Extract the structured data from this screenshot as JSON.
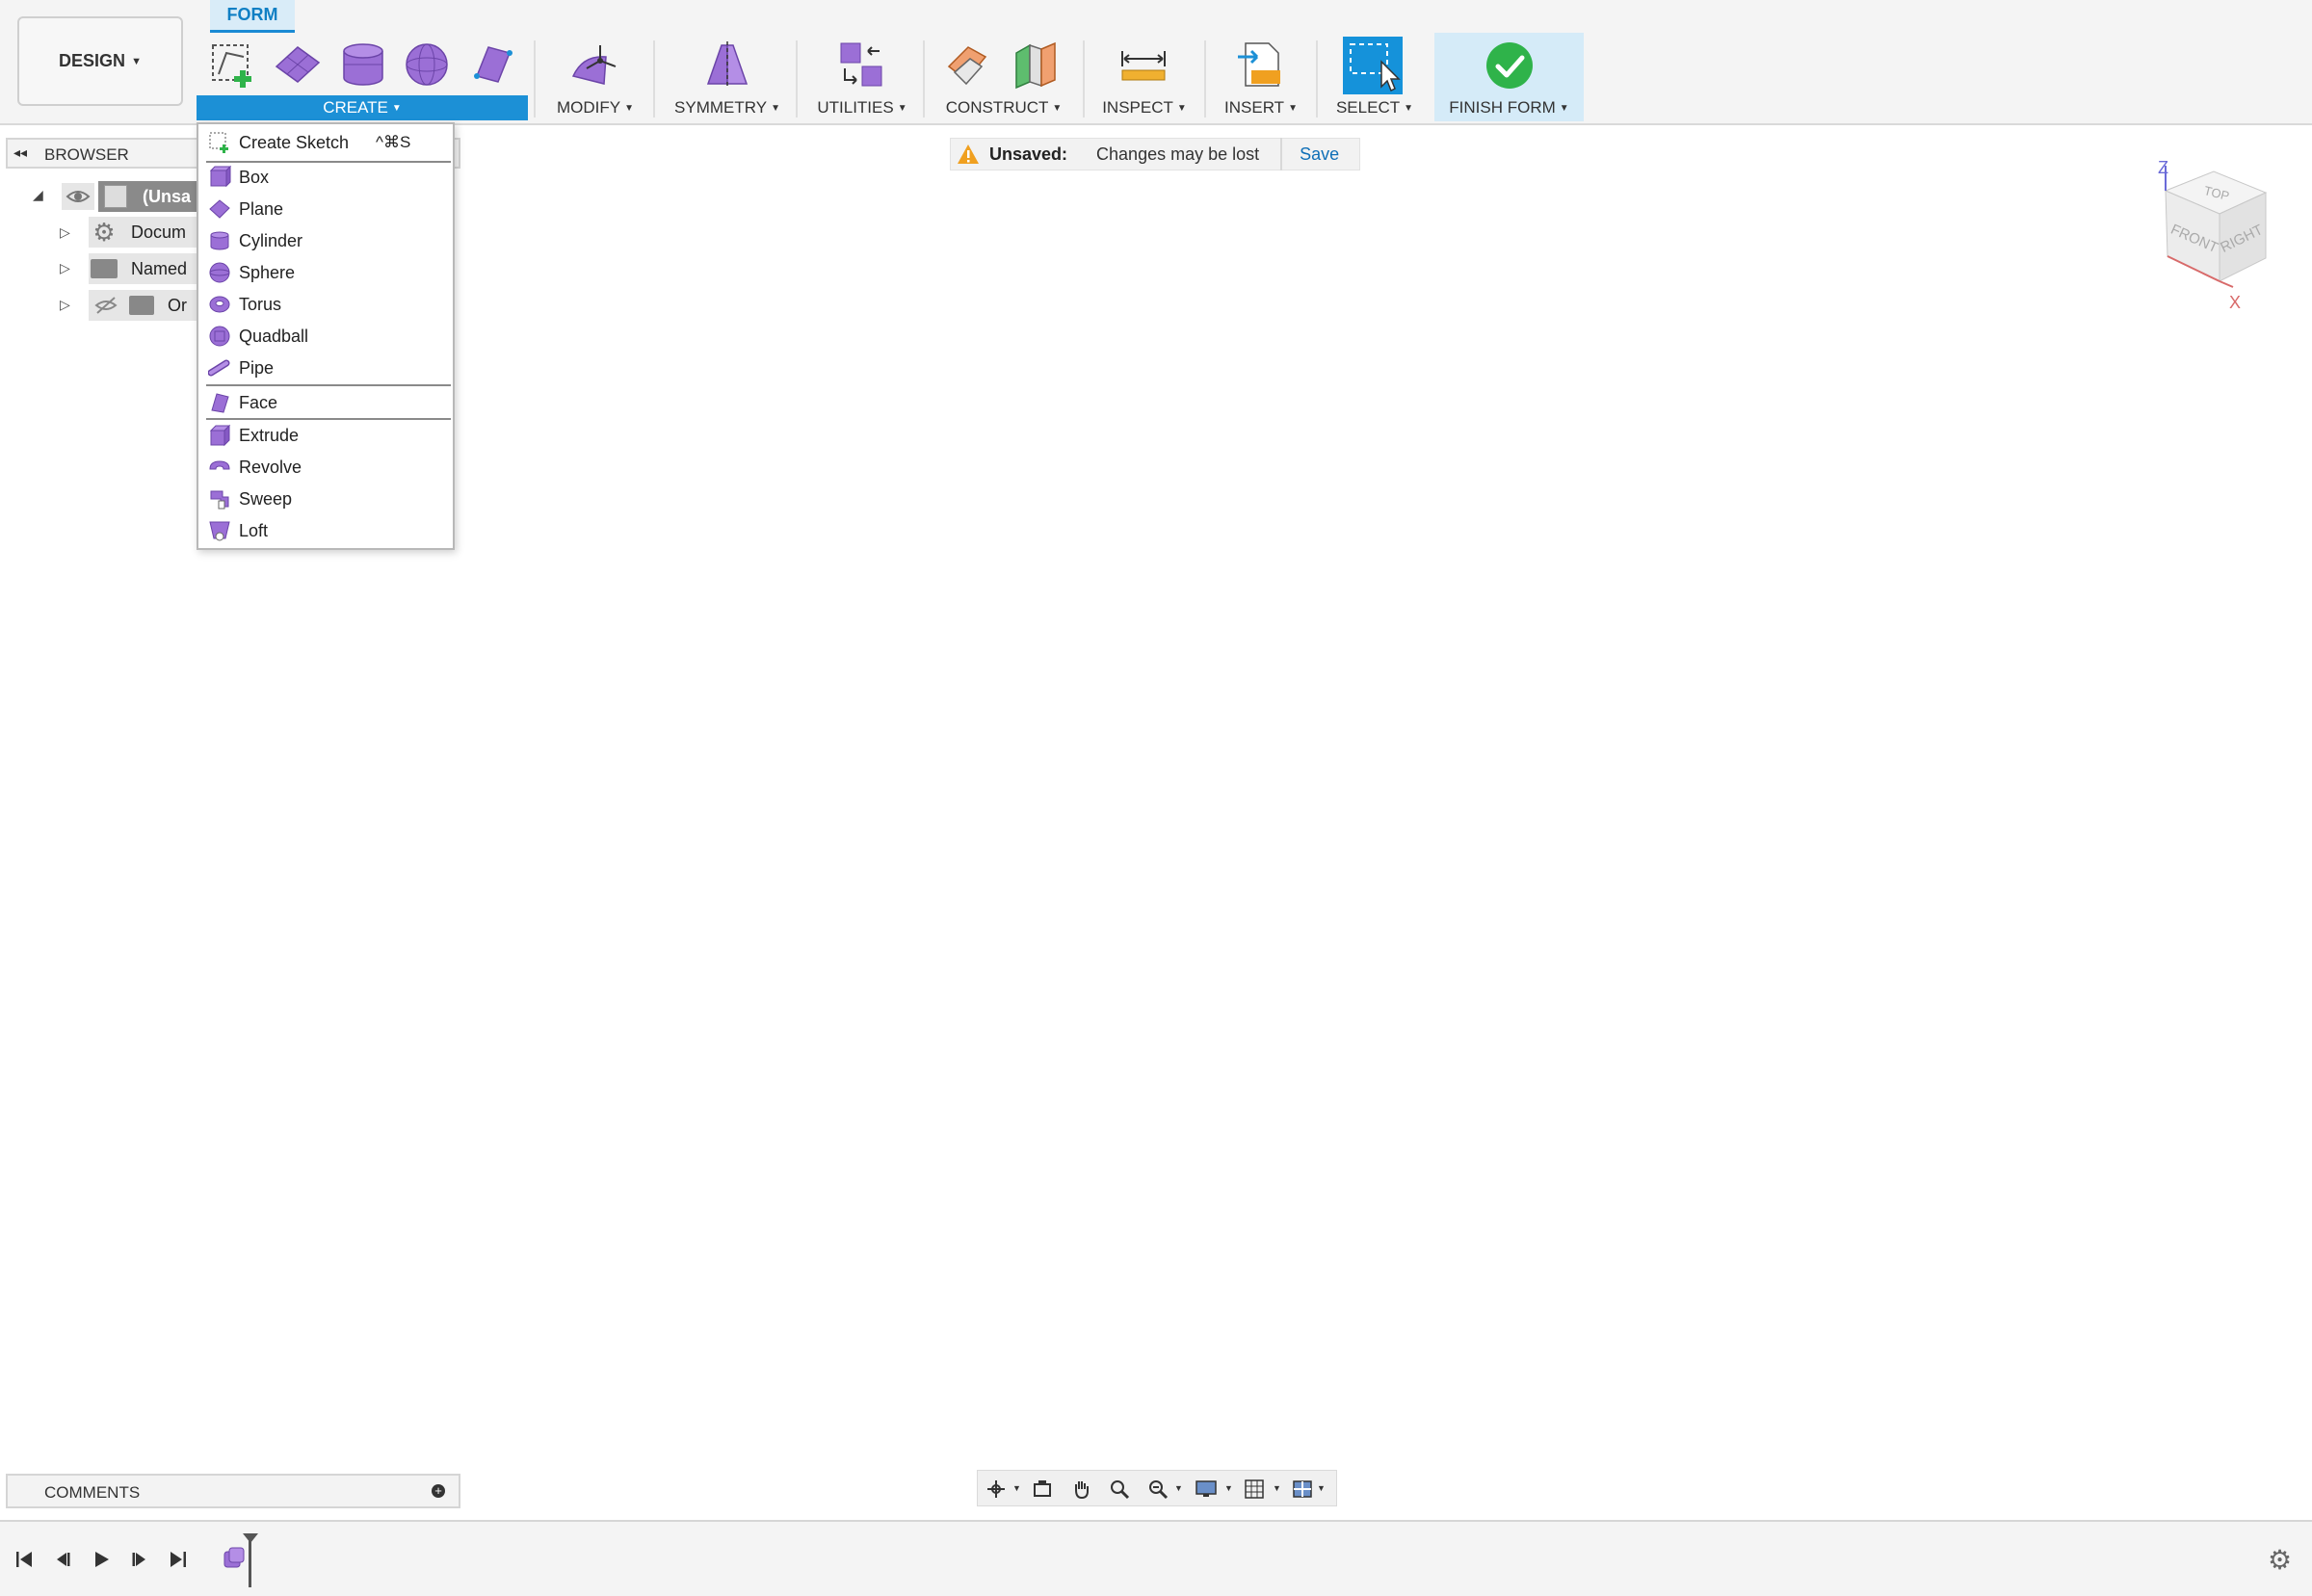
{
  "workspace": {
    "label": "DESIGN"
  },
  "active_tab": {
    "label": "FORM"
  },
  "toolbar": {
    "groups": [
      {
        "label": "CREATE"
      },
      {
        "label": "MODIFY"
      },
      {
        "label": "SYMMETRY"
      },
      {
        "label": "UTILITIES"
      },
      {
        "label": "CONSTRUCT"
      },
      {
        "label": "INSPECT"
      },
      {
        "label": "INSERT"
      },
      {
        "label": "SELECT"
      },
      {
        "label": "FINISH FORM"
      }
    ]
  },
  "create_menu": {
    "items": [
      {
        "label": "Create Sketch",
        "shortcut": "^⌘S",
        "icon": "create-sketch-icon"
      },
      {
        "label": "Box",
        "icon": "box-icon"
      },
      {
        "label": "Plane",
        "icon": "plane-icon"
      },
      {
        "label": "Cylinder",
        "icon": "cylinder-icon"
      },
      {
        "label": "Sphere",
        "icon": "sphere-icon"
      },
      {
        "label": "Torus",
        "icon": "torus-icon"
      },
      {
        "label": "Quadball",
        "icon": "quadball-icon"
      },
      {
        "label": "Pipe",
        "icon": "pipe-icon"
      },
      {
        "label": "Face",
        "icon": "face-icon"
      },
      {
        "label": "Extrude",
        "icon": "extrude-icon"
      },
      {
        "label": "Revolve",
        "icon": "revolve-icon"
      },
      {
        "label": "Sweep",
        "icon": "sweep-icon"
      },
      {
        "label": "Loft",
        "icon": "loft-icon"
      }
    ]
  },
  "browser": {
    "title": "BROWSER",
    "items": [
      {
        "label": "(Unsa"
      },
      {
        "label": "Docum"
      },
      {
        "label": "Named"
      },
      {
        "label": "Or"
      }
    ]
  },
  "notice": {
    "title": "Unsaved:",
    "message": "Changes may be lost",
    "action": "Save"
  },
  "viewcube": {
    "top": "TOP",
    "front": "FRONT",
    "right": "RIGHT",
    "axis_z": "Z",
    "axis_x": "X"
  },
  "comments": {
    "title": "COMMENTS"
  },
  "colors": {
    "accent": "#1c90d6",
    "form_purple": "#9b6fd6",
    "success": "#2fb34a",
    "warning": "#f0a020"
  }
}
